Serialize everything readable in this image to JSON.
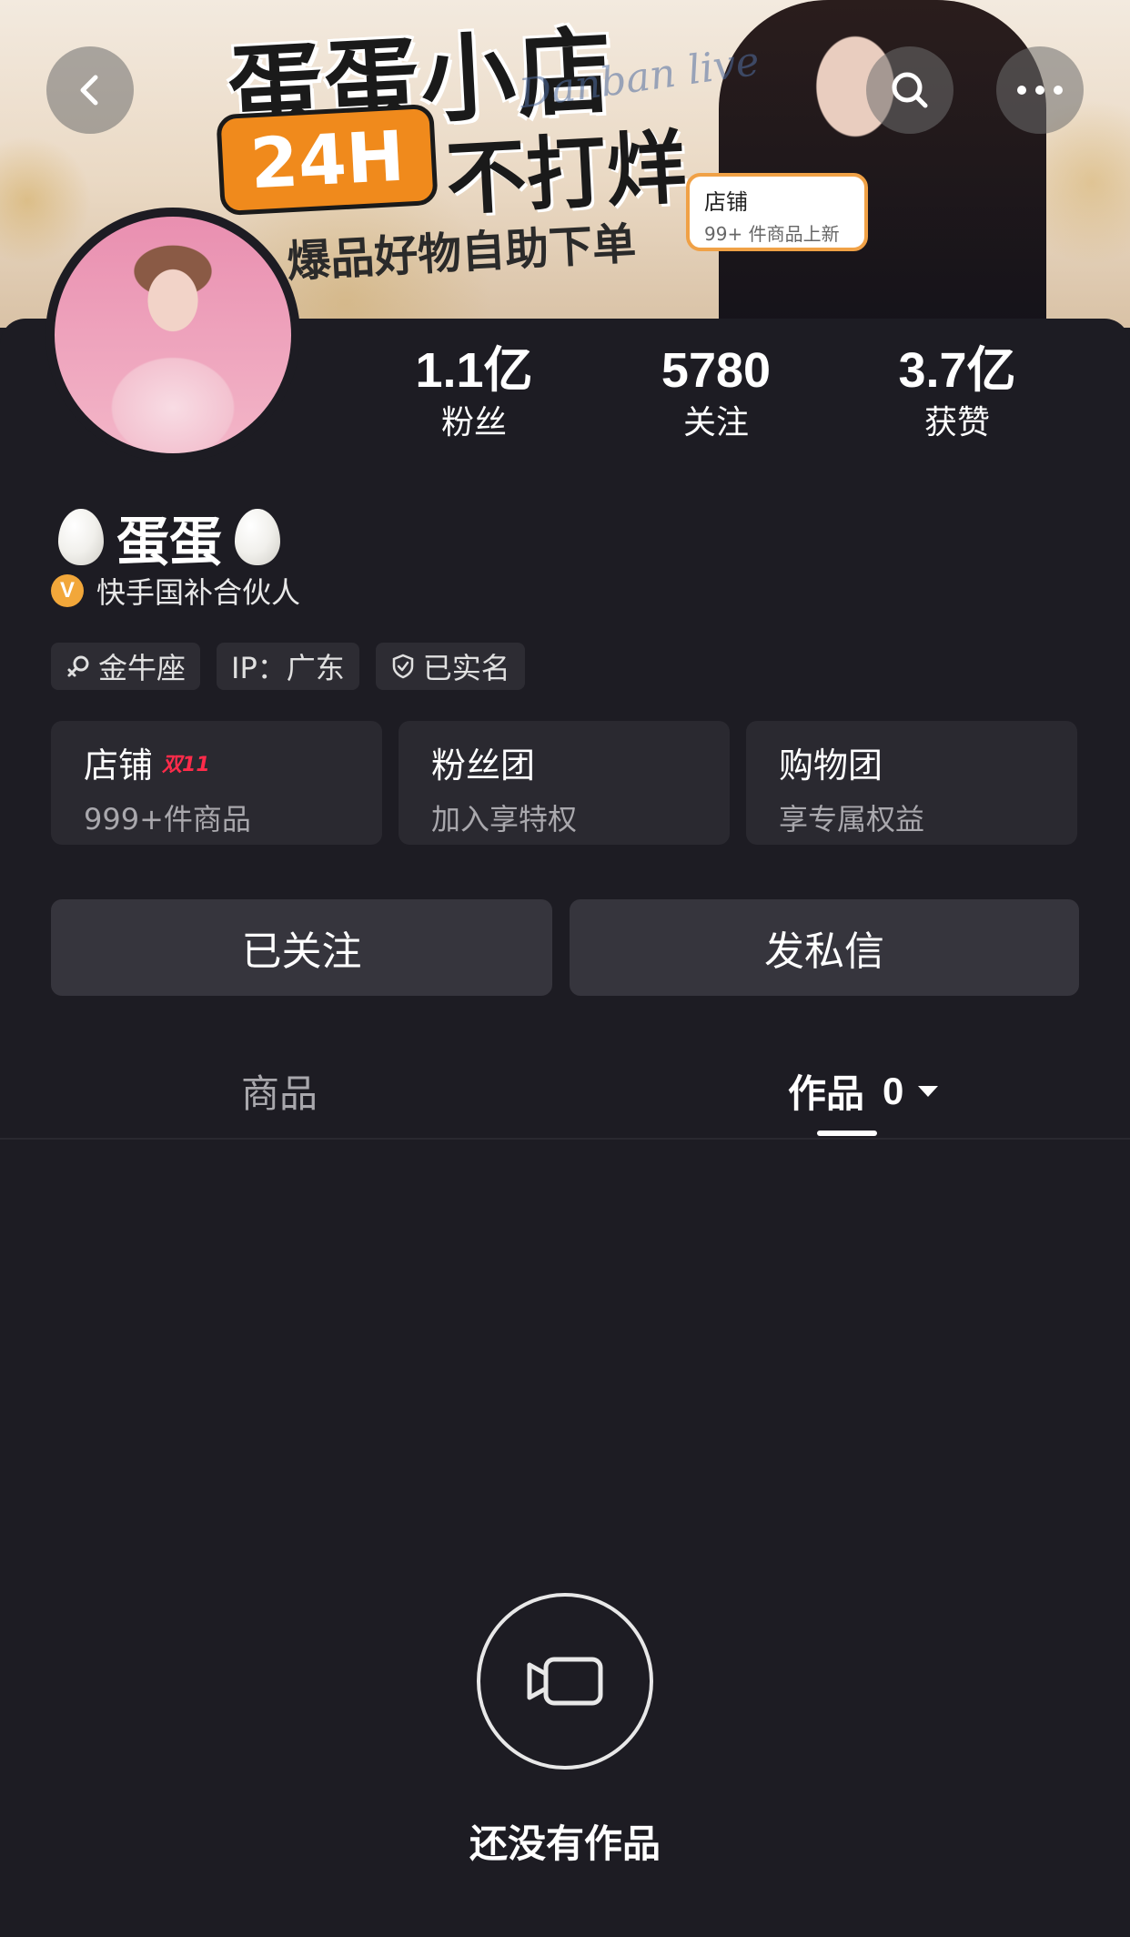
{
  "banner": {
    "title": "蛋蛋小店",
    "tag_24h": "24H",
    "tag_text": "不打烊",
    "subtitle": "爆品好物自助下单",
    "script_text": "Danban live",
    "card_title": "店铺",
    "card_subtitle": "99+ 件商品上新"
  },
  "top_bar": {
    "back_icon": "chevron-left-icon",
    "search_icon": "search-icon",
    "more_icon": "more-dots-icon"
  },
  "profile": {
    "name": "蛋蛋",
    "verified_label": "快手国补合伙人",
    "verified_badge": "V",
    "stats": [
      {
        "value": "1.1亿",
        "label": "粉丝"
      },
      {
        "value": "5780",
        "label": "关注"
      },
      {
        "value": "3.7亿",
        "label": "获赞"
      }
    ],
    "tags": [
      {
        "text": "金牛座",
        "icon": "gender-female-icon"
      },
      {
        "text": "IP：广东",
        "icon": ""
      },
      {
        "text": "已实名",
        "icon": "shield-check-icon"
      }
    ]
  },
  "cards": [
    {
      "title": "店铺",
      "badge": "双11",
      "subtitle": "999+件商品"
    },
    {
      "title": "粉丝团",
      "badge": "",
      "subtitle": "加入享特权"
    },
    {
      "title": "购物团",
      "badge": "",
      "subtitle": "享专属权益"
    }
  ],
  "actions": {
    "follow": "已关注",
    "message": "发私信"
  },
  "tabs": {
    "goods": "商品",
    "works": "作品",
    "works_count": "0"
  },
  "empty_state": {
    "icon": "video-camera-icon",
    "text": "还没有作品"
  },
  "colors": {
    "background": "#1d1c23",
    "card": "#2a2930",
    "button": "#36353d",
    "accent_orange": "#f08a1c",
    "badge_red": "#ff2b4a",
    "verify_gold": "#f2a73a"
  }
}
